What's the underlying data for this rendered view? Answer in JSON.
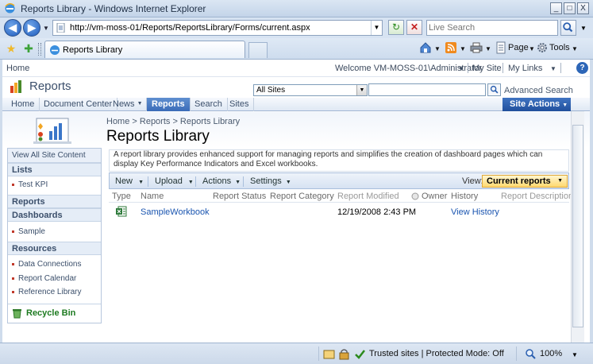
{
  "window": {
    "title": "Reports Library - Windows Internet Explorer",
    "minimize": "_",
    "maximize": "□",
    "close": "X"
  },
  "address": {
    "url": "http://vm-moss-01/Reports/ReportsLibrary/Forms/current.aspx",
    "search_placeholder": "Live Search"
  },
  "tab": {
    "title": "Reports Library"
  },
  "commandbar": {
    "page": "Page",
    "tools": "Tools"
  },
  "global": {
    "home": "Home",
    "welcome": "Welcome VM-MOSS-01\\Administrator",
    "my_site": "My Site",
    "my_links": "My Links",
    "help": "?"
  },
  "site": {
    "title": "Reports",
    "scope": "All Sites",
    "advanced_search": "Advanced Search"
  },
  "topnav": {
    "items": [
      {
        "label": "Home"
      },
      {
        "label": "Document Center"
      },
      {
        "label": "News"
      },
      {
        "label": "Reports"
      },
      {
        "label": "Search"
      },
      {
        "label": "Sites"
      }
    ],
    "site_actions": "Site Actions"
  },
  "breadcrumb": "Home > Reports > Reports Library",
  "page_title": "Reports Library",
  "leftnav": {
    "view_all": "View All Site Content",
    "sections": {
      "lists": "Lists",
      "reports": "Reports",
      "dashboards": "Dashboards",
      "resources": "Resources"
    },
    "links": {
      "test_kpi": "Test KPI",
      "sample": "Sample",
      "data_connections": "Data Connections",
      "report_calendar": "Report Calendar",
      "reference_library": "Reference Library"
    },
    "recycle_bin": "Recycle Bin"
  },
  "description": "A report library provides enhanced support for managing reports and simplifies the creation of dashboard pages which can display Key Performance Indicators and Excel workbooks.",
  "toolbar": {
    "new": "New",
    "upload": "Upload",
    "actions": "Actions",
    "settings": "Settings",
    "view_label": "View:",
    "view_value": "Current reports"
  },
  "list": {
    "columns": {
      "type": "Type",
      "name": "Name",
      "status": "Report Status",
      "category": "Report Category",
      "modified": "Report Modified",
      "owner": "Owner",
      "history": "History",
      "report_description": "Report Description"
    },
    "rows": [
      {
        "name": "SampleWorkbook",
        "modified": "12/19/2008 2:43 PM",
        "history": "View History"
      }
    ]
  },
  "status": {
    "zone": "Trusted sites | Protected Mode: Off",
    "zoom": "100%"
  }
}
